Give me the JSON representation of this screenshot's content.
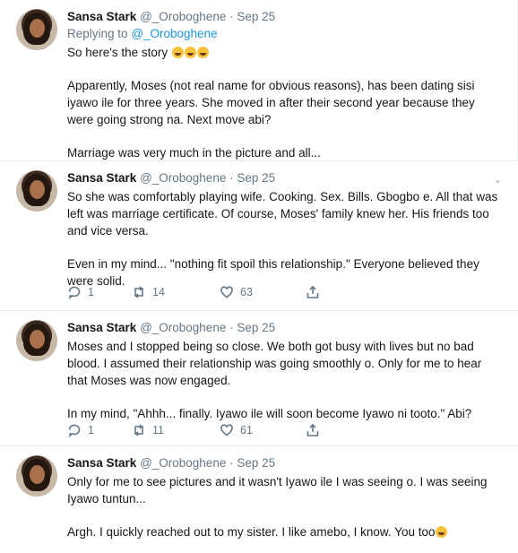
{
  "tweets": [
    {
      "name": "Sansa Stark",
      "handle": "@_Oroboghene",
      "date": "Sep 25",
      "reply_prefix": "Replying to",
      "reply_to": "@_Oroboghene",
      "paragraphs": [
        "So here's the story",
        "Apparently, Moses (not real name for obvious reasons), has been dating sisi iyawo ile for three years. She moved in after their second year because they were going strong na. Next move abi?",
        "Marriage was very much in the picture and all..."
      ]
    },
    {
      "name": "Sansa Stark",
      "handle": "@_Oroboghene",
      "date": "Sep 25",
      "paragraphs": [
        "So she was comfortably playing wife. Cooking. Sex. Bills. Gbogbo e. All that was left was marriage certificate. Of course, Moses' family knew her. His friends too and vice versa.",
        "Even in my mind... \"nothing fit spoil this relationship.\" Everyone believed they were solid."
      ],
      "replies": "1",
      "retweets": "14",
      "likes": "63"
    },
    {
      "name": "Sansa Stark",
      "handle": "@_Oroboghene",
      "date": "Sep 25",
      "paragraphs": [
        "Moses and I stopped being so close. We both got busy with lives but no bad blood. I assumed their relationship was going smoothly o. Only for me to hear that Moses was now engaged.",
        "In my mind, \"Ahhh... finally. Iyawo ile will soon become Iyawo ni tooto.\" Abi?"
      ],
      "replies": "1",
      "retweets": "11",
      "likes": "61"
    },
    {
      "name": "Sansa Stark",
      "handle": "@_Oroboghene",
      "date": "Sep 25",
      "paragraphs": [
        "Only for me to see pictures and it wasn't Iyawo ile I was seeing o. I was seeing Iyawo tuntun...",
        "Argh. I quickly reached out to my sister. I like amebo, I know. You too"
      ]
    }
  ],
  "separator": "·",
  "icons": {
    "reply": "reply-icon",
    "retweet": "retweet-icon",
    "like": "heart-icon",
    "share": "share-icon",
    "menu": "chevron-down-icon"
  }
}
